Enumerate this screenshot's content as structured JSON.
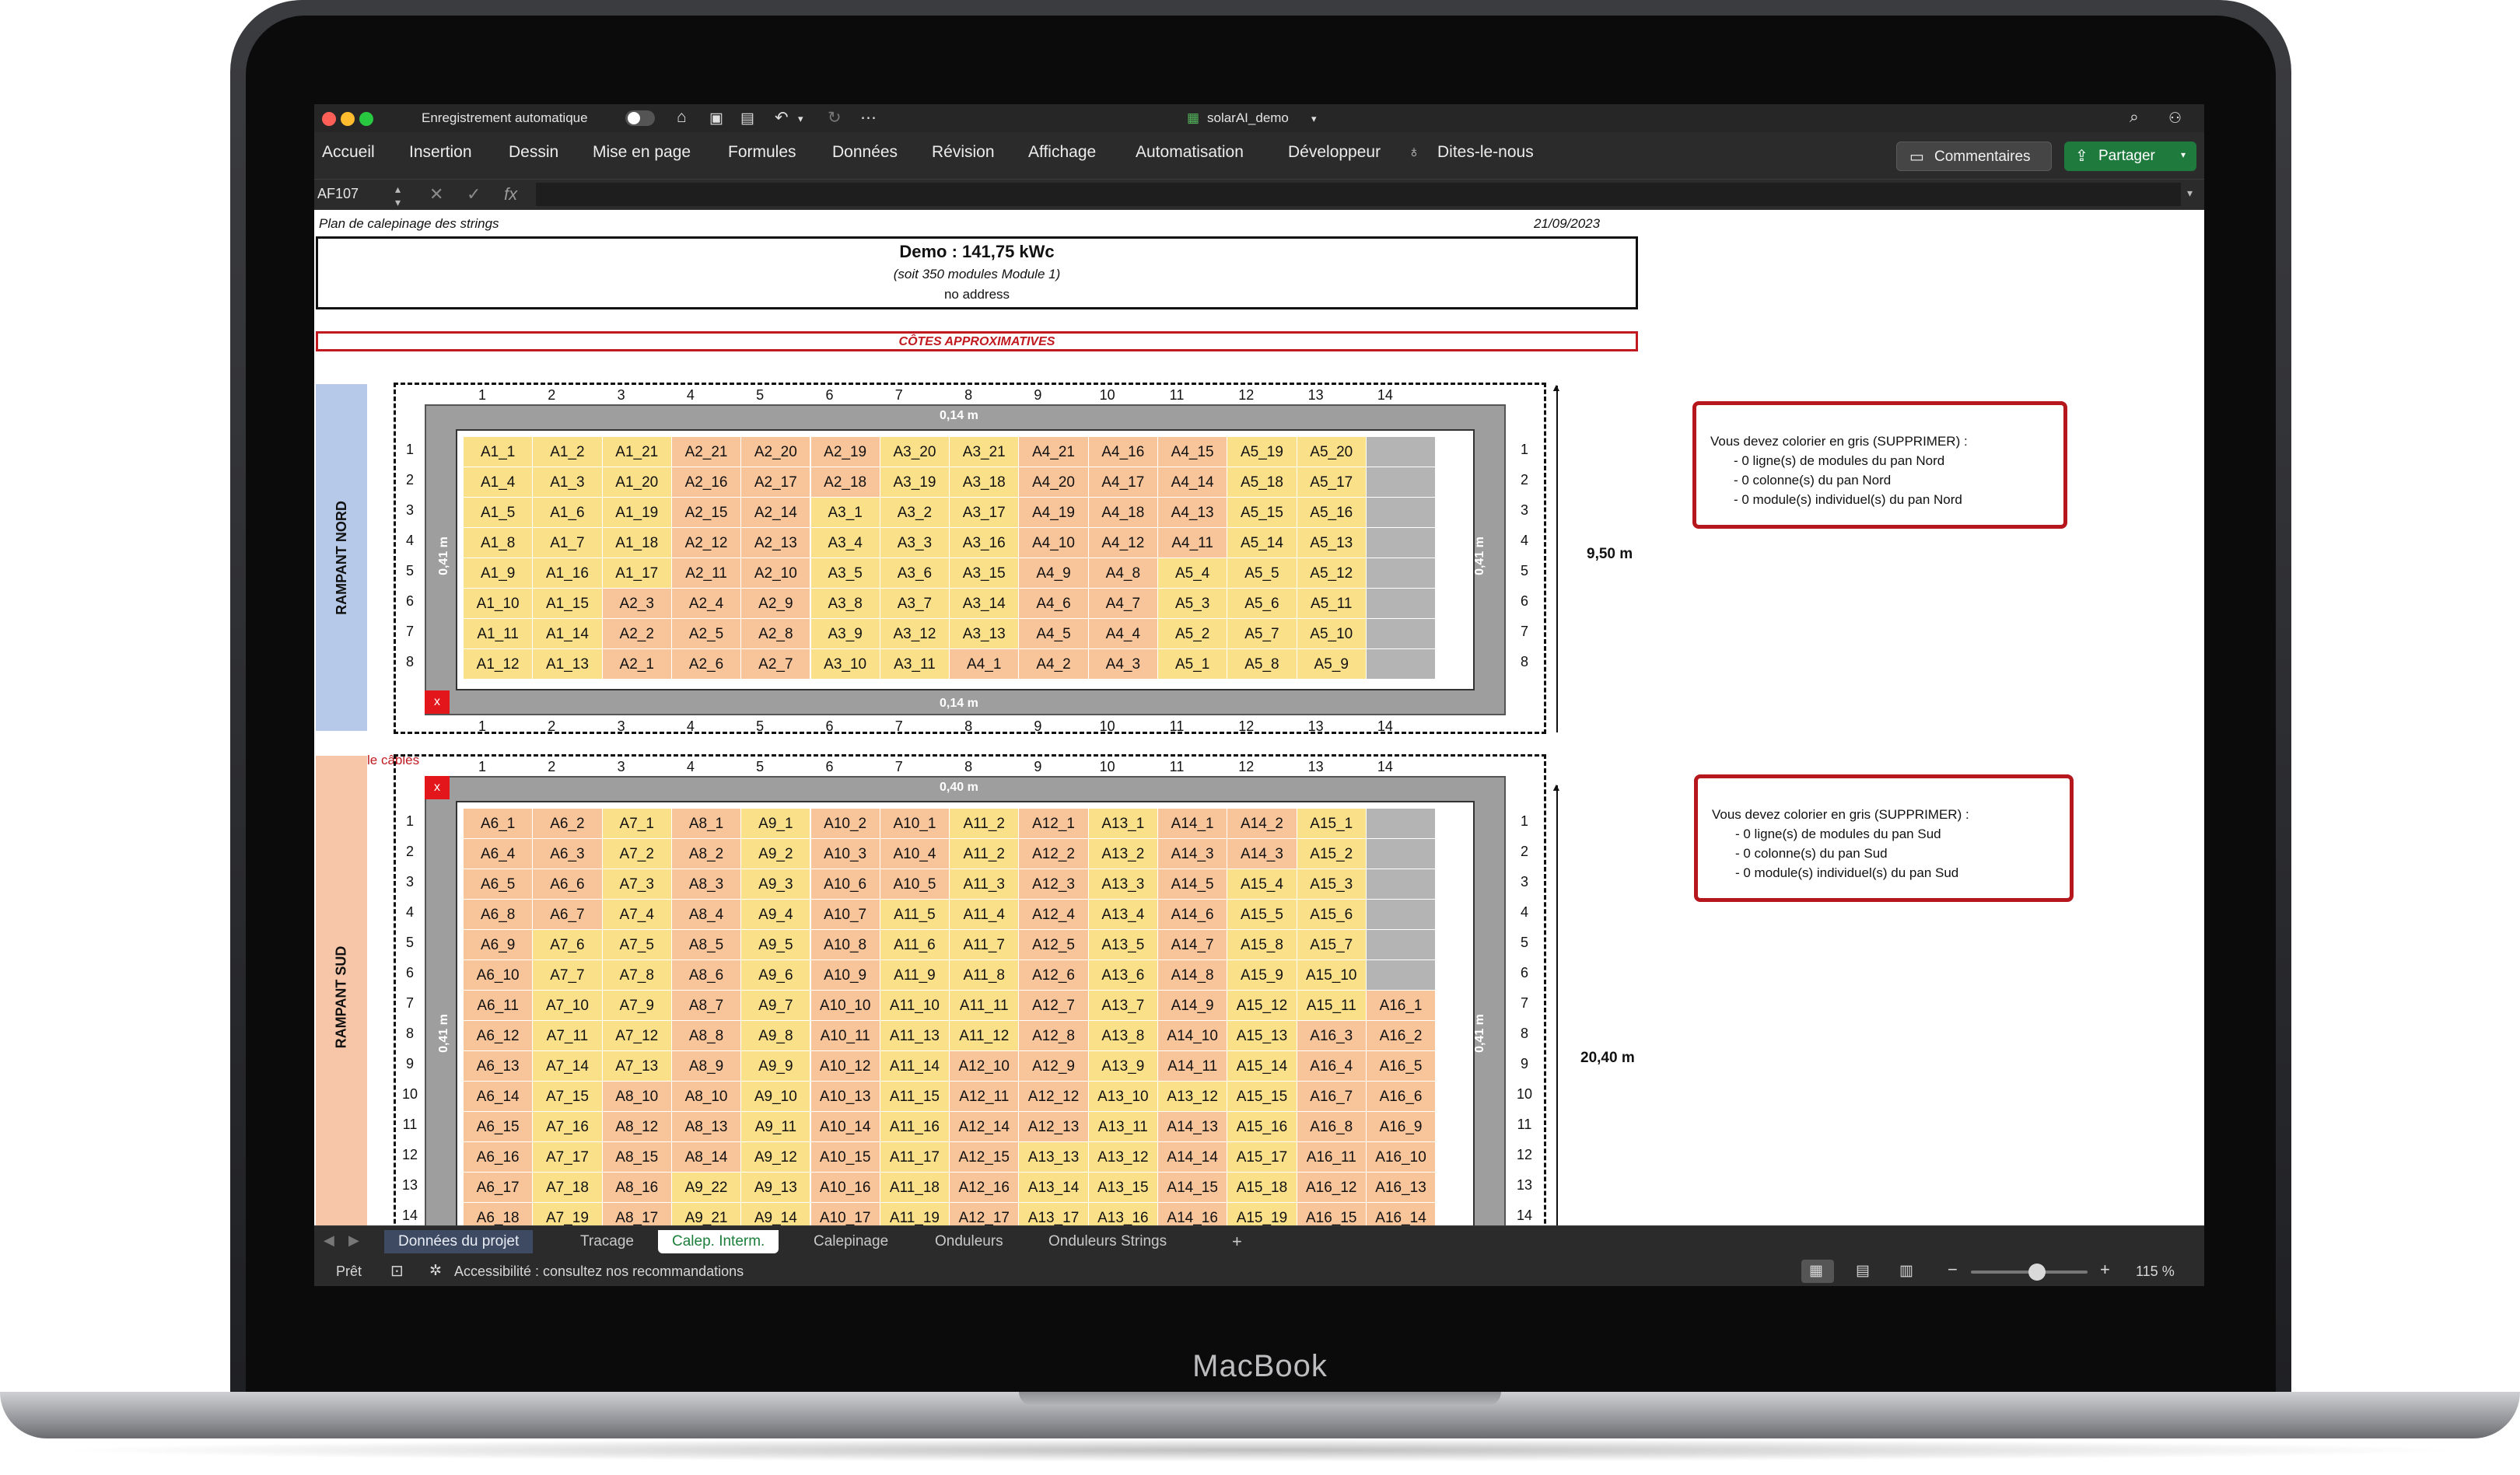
{
  "device": {
    "brand": "MacBook"
  },
  "window": {
    "autosave_label": "Enregistrement automatique",
    "file_name": "solarAI_demo"
  },
  "menu": [
    "Accueil",
    "Insertion",
    "Dessin",
    "Mise en page",
    "Formules",
    "Données",
    "Révision",
    "Affichage",
    "Automatisation",
    "Développeur",
    "Dites-le-nous"
  ],
  "actions": {
    "comments": "Commentaires",
    "share": "Partager"
  },
  "formula_bar": {
    "cell_ref": "AF107",
    "fx": "fx"
  },
  "sheet": {
    "doc_title": "Plan de calepinage des strings",
    "date": "21/09/2023",
    "header_title": "Demo : 141,75 kWc",
    "header_sub": "(soit 350 modules Module 1)",
    "header_address": "no address",
    "cotes": "CÔTES APPROXIMATIVES",
    "cables_label": "le câbles",
    "column_numbers": [
      "1",
      "2",
      "3",
      "4",
      "5",
      "6",
      "7",
      "8",
      "9",
      "10",
      "11",
      "12",
      "13",
      "14"
    ],
    "north": {
      "side_label": "RAMPANT NORD",
      "top_dim": "0,14 m",
      "bottom_dim": "0,14 m",
      "side_dim": "0,41 m",
      "height": "9,50 m",
      "x_mark": "x",
      "rows": [
        [
          "A1_1",
          "A1_2",
          "A1_21",
          "A2_21",
          "A2_20",
          "A2_19",
          "A3_20",
          "A3_21",
          "A4_21",
          "A4_16",
          "A4_15",
          "A5_19",
          "A5_20",
          ""
        ],
        [
          "A1_4",
          "A1_3",
          "A1_20",
          "A2_16",
          "A2_17",
          "A2_18",
          "A3_19",
          "A3_18",
          "A4_20",
          "A4_17",
          "A4_14",
          "A5_18",
          "A5_17",
          ""
        ],
        [
          "A1_5",
          "A1_6",
          "A1_19",
          "A2_15",
          "A2_14",
          "A3_1",
          "A3_2",
          "A3_17",
          "A4_19",
          "A4_18",
          "A4_13",
          "A5_15",
          "A5_16",
          ""
        ],
        [
          "A1_8",
          "A1_7",
          "A1_18",
          "A2_12",
          "A2_13",
          "A3_4",
          "A3_3",
          "A3_16",
          "A4_10",
          "A4_12",
          "A4_11",
          "A5_14",
          "A5_13",
          ""
        ],
        [
          "A1_9",
          "A1_16",
          "A1_17",
          "A2_11",
          "A2_10",
          "A3_5",
          "A3_6",
          "A3_15",
          "A4_9",
          "A4_8",
          "A5_4",
          "A5_5",
          "A5_12",
          ""
        ],
        [
          "A1_10",
          "A1_15",
          "A2_3",
          "A2_4",
          "A2_9",
          "A3_8",
          "A3_7",
          "A3_14",
          "A4_6",
          "A4_7",
          "A5_3",
          "A5_6",
          "A5_11",
          ""
        ],
        [
          "A1_11",
          "A1_14",
          "A2_2",
          "A2_5",
          "A2_8",
          "A3_9",
          "A3_12",
          "A3_13",
          "A4_5",
          "A4_4",
          "A5_2",
          "A5_7",
          "A5_10",
          ""
        ],
        [
          "A1_12",
          "A1_13",
          "A2_1",
          "A2_6",
          "A2_7",
          "A3_10",
          "A3_11",
          "A4_1",
          "A4_2",
          "A4_3",
          "A5_1",
          "A5_8",
          "A5_9",
          ""
        ]
      ],
      "note_lines": [
        "Vous devez colorier en gris (SUPPRIMER) :",
        "- 0 ligne(s) de modules du pan Nord",
        "- 0 colonne(s) du pan Nord",
        "- 0 module(s) individuel(s) du pan Nord"
      ]
    },
    "south": {
      "side_label": "RAMPANT SUD",
      "top_dim": "0,40 m",
      "side_dim": "0,41 m",
      "height": "20,40 m",
      "x_mark": "x",
      "rows": [
        [
          "A6_1",
          "A6_2",
          "A7_1",
          "A8_1",
          "A9_1",
          "A10_2",
          "A10_1",
          "A11_2",
          "A12_1",
          "A13_1",
          "A14_1",
          "A14_2",
          "A15_1",
          ""
        ],
        [
          "A6_4",
          "A6_3",
          "A7_2",
          "A8_2",
          "A9_2",
          "A10_3",
          "A10_4",
          "A11_2",
          "A12_2",
          "A13_2",
          "A14_3",
          "A14_3",
          "A15_2",
          ""
        ],
        [
          "A6_5",
          "A6_6",
          "A7_3",
          "A8_3",
          "A9_3",
          "A10_6",
          "A10_5",
          "A11_3",
          "A12_3",
          "A13_3",
          "A14_5",
          "A15_4",
          "A15_3",
          ""
        ],
        [
          "A6_8",
          "A6_7",
          "A7_4",
          "A8_4",
          "A9_4",
          "A10_7",
          "A11_5",
          "A11_4",
          "A12_4",
          "A13_4",
          "A14_6",
          "A15_5",
          "A15_6",
          ""
        ],
        [
          "A6_9",
          "A7_6",
          "A7_5",
          "A8_5",
          "A9_5",
          "A10_8",
          "A11_6",
          "A11_7",
          "A12_5",
          "A13_5",
          "A14_7",
          "A15_8",
          "A15_7",
          ""
        ],
        [
          "A6_10",
          "A7_7",
          "A7_8",
          "A8_6",
          "A9_6",
          "A10_9",
          "A11_9",
          "A11_8",
          "A12_6",
          "A13_6",
          "A14_8",
          "A15_9",
          "A15_10",
          ""
        ],
        [
          "A6_11",
          "A7_10",
          "A7_9",
          "A8_7",
          "A9_7",
          "A10_10",
          "A11_10",
          "A11_11",
          "A12_7",
          "A13_7",
          "A14_9",
          "A15_12",
          "A15_11",
          "A16_1"
        ],
        [
          "A6_12",
          "A7_11",
          "A7_12",
          "A8_8",
          "A9_8",
          "A10_11",
          "A11_13",
          "A11_12",
          "A12_8",
          "A13_8",
          "A14_10",
          "A15_13",
          "A16_3",
          "A16_2"
        ],
        [
          "A6_13",
          "A7_14",
          "A7_13",
          "A8_9",
          "A9_9",
          "A10_12",
          "A11_14",
          "A12_10",
          "A12_9",
          "A13_9",
          "A14_11",
          "A15_14",
          "A16_4",
          "A16_5"
        ],
        [
          "A6_14",
          "A7_15",
          "A8_10",
          "A8_10",
          "A9_10",
          "A10_13",
          "A11_15",
          "A12_11",
          "A12_12",
          "A13_10",
          "A13_12",
          "A15_15",
          "A16_7",
          "A16_6"
        ],
        [
          "A6_15",
          "A7_16",
          "A8_12",
          "A8_13",
          "A9_11",
          "A10_14",
          "A11_16",
          "A12_14",
          "A12_13",
          "A13_11",
          "A14_13",
          "A15_16",
          "A16_8",
          "A16_9"
        ],
        [
          "A6_16",
          "A7_17",
          "A8_15",
          "A8_14",
          "A9_12",
          "A10_15",
          "A11_17",
          "A12_15",
          "A13_13",
          "A13_12",
          "A14_14",
          "A15_17",
          "A16_11",
          "A16_10"
        ],
        [
          "A6_17",
          "A7_18",
          "A8_16",
          "A9_22",
          "A9_13",
          "A10_16",
          "A11_18",
          "A12_16",
          "A13_14",
          "A13_15",
          "A14_15",
          "A15_18",
          "A16_12",
          "A16_13"
        ],
        [
          "A6_18",
          "A7_19",
          "A8_17",
          "A9_21",
          "A9_14",
          "A10_17",
          "A11_19",
          "A12_17",
          "A13_17",
          "A13_16",
          "A14_16",
          "A15_19",
          "A16_15",
          "A16_14"
        ]
      ],
      "note_lines": [
        "Vous devez colorier en gris (SUPPRIMER) :",
        "- 0 ligne(s) de modules du pan Sud",
        "- 0 colonne(s) du pan Sud",
        "- 0 module(s) individuel(s) du pan Sud"
      ]
    }
  },
  "tabs": [
    "Données du projet",
    "Tracage",
    "Calep. Interm.",
    "Calepinage",
    "Onduleurs",
    "Onduleurs Strings",
    "+"
  ],
  "status": {
    "ready": "Prêt",
    "accessibility": "Accessibilité : consultez nos recommandations",
    "zoom": "115 %"
  },
  "colors": {
    "yellow": "#fbe08a",
    "orange": "#f8c49a",
    "gray": "#b4b4b4",
    "north_band": "#b6c9e8",
    "south_band": "#f7c6a8",
    "accent_red": "#c0191f",
    "share_green": "#1f7a3e"
  }
}
